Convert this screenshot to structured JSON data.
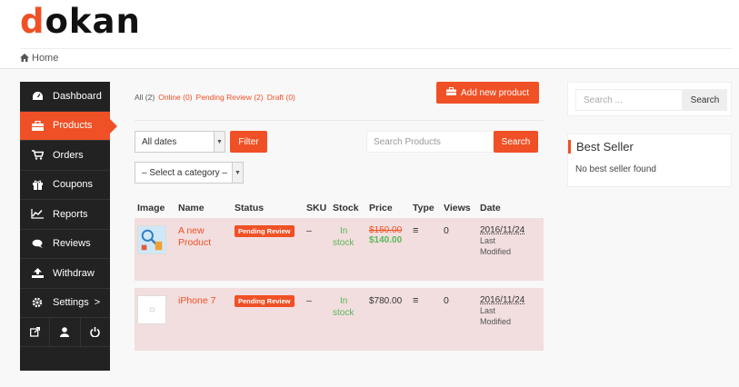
{
  "brand": {
    "logo_first": "d",
    "logo_rest": "okan",
    "accent": "#f05025"
  },
  "breadcrumb": {
    "home": "Home"
  },
  "sidebar": {
    "items": [
      {
        "label": "Dashboard",
        "icon": "dashboard-icon"
      },
      {
        "label": "Products",
        "icon": "briefcase-icon",
        "active": true
      },
      {
        "label": "Orders",
        "icon": "cart-icon"
      },
      {
        "label": "Coupons",
        "icon": "gift-icon"
      },
      {
        "label": "Reports",
        "icon": "chart-icon"
      },
      {
        "label": "Reviews",
        "icon": "comments-icon"
      },
      {
        "label": "Withdraw",
        "icon": "upload-icon"
      },
      {
        "label": "Settings",
        "icon": "gear-icon",
        "chevron": ">"
      }
    ],
    "bottom_icons": [
      "external-link-icon",
      "user-icon",
      "power-icon"
    ]
  },
  "status_filters": {
    "all": "All (2)",
    "online": "Online (0)",
    "pending": "Pending Review (2)",
    "draft": "Draft (0)"
  },
  "add_button": "Add new product",
  "filter_bar": {
    "dates_value": "All dates",
    "filter_label": "Filter",
    "search_placeholder": "Search Products",
    "search_label": "Search",
    "category_value": "– Select a category –"
  },
  "table": {
    "headers": [
      "Image",
      "Name",
      "Status",
      "SKU",
      "Stock",
      "Price",
      "Type",
      "Views",
      "Date"
    ],
    "rows": [
      {
        "name_line1": "A new",
        "name_line2": "Product",
        "status": "Pending Review",
        "sku": "–",
        "stock_line1": "In",
        "stock_line2": "stock",
        "price_old": "$150.00",
        "price_new": "$140.00",
        "views": "0",
        "date": "2016/11/24",
        "date_sub1": "Last",
        "date_sub2": "Modified"
      },
      {
        "name_line1": "iPhone 7",
        "status": "Pending Review",
        "sku": "–",
        "stock_line1": "In",
        "stock_line2": "stock",
        "price": "$780.00",
        "views": "0",
        "date": "2016/11/24",
        "date_sub1": "Last",
        "date_sub2": "Modified"
      }
    ]
  },
  "widgets": {
    "search_placeholder": "Search ...",
    "search_button": "Search",
    "best_seller_title": "Best Seller",
    "best_seller_msg": "No best seller found"
  }
}
